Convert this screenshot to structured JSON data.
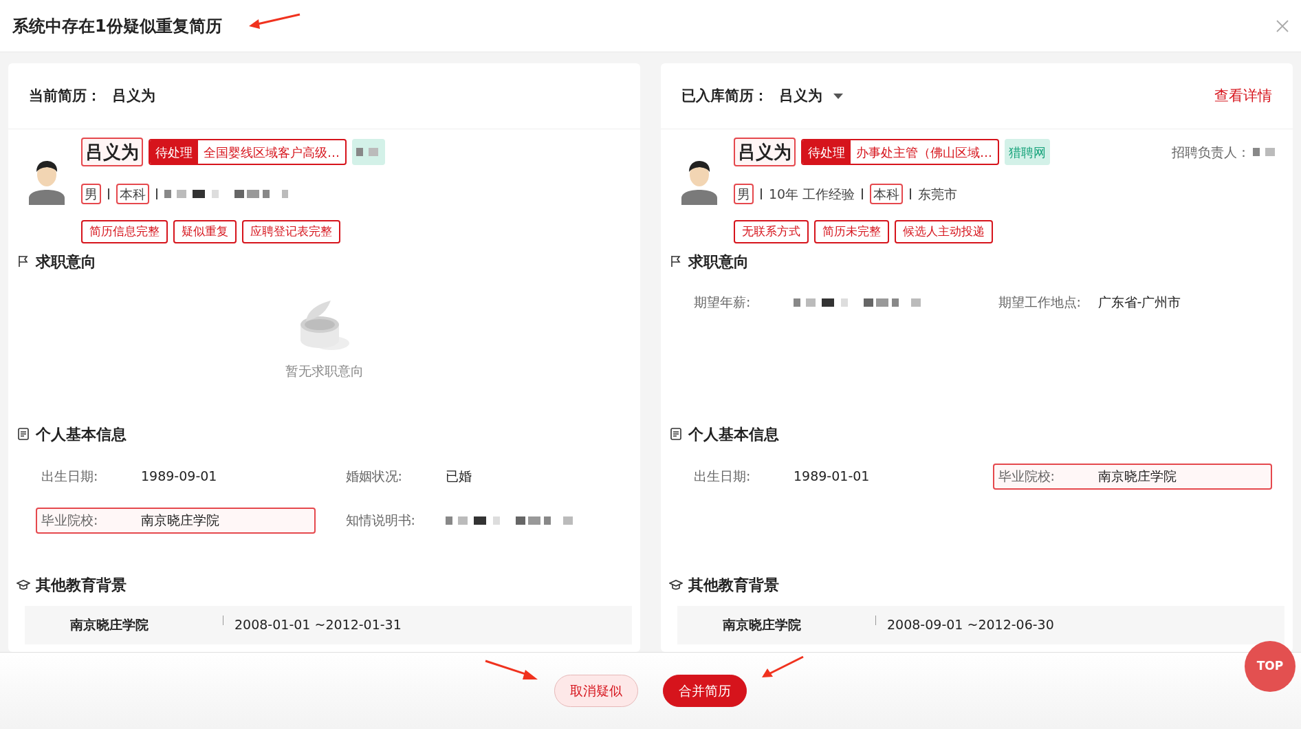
{
  "dialog": {
    "title": "系统中存在1份疑似重复简历"
  },
  "panels": [
    {
      "header_label": "当前简历：",
      "header_name": "吕义为",
      "name": "吕义为",
      "status": "待处理",
      "position": "全国婴线区域客户高级…",
      "source": {
        "blurred": true
      },
      "info": [
        {
          "kind": "tag",
          "text": "男"
        },
        {
          "kind": "tag",
          "text": "本科"
        },
        {
          "kind": "blurred"
        }
      ],
      "tags": [
        "简历信息完整",
        "疑似重复",
        "应聘登记表完整"
      ],
      "intent_title": "求职意向",
      "intent": {
        "empty": true,
        "empty_text": "暂无求职意向"
      },
      "basic_title": "个人基本信息",
      "basic": [
        {
          "label": "出生日期:",
          "value": "1989-09-01",
          "highlighted": false
        },
        {
          "label": "婚姻状况:",
          "value": "已婚",
          "highlighted": false
        },
        {
          "label": "毕业院校:",
          "value": "南京晓庄学院",
          "highlighted": true
        },
        {
          "label": "知情说明书:",
          "blurred": true,
          "highlighted": false
        }
      ],
      "edu_title": "其他教育背景",
      "education": [
        {
          "school": "南京晓庄学院",
          "period": "2008-01-01 ~2012-01-31"
        }
      ]
    },
    {
      "header_label": "已入库简历：",
      "header_name": "吕义为",
      "dropdown": true,
      "link": "查看详情",
      "name": "吕义为",
      "status": "待处理",
      "position": "办事处主管（佛山区域…",
      "source": {
        "text": "猎聘网"
      },
      "recruiter_label": "招聘负责人：",
      "info": [
        {
          "kind": "tag",
          "text": "男"
        },
        {
          "kind": "text",
          "text": "10年 工作经验"
        },
        {
          "kind": "tag",
          "text": "本科"
        },
        {
          "kind": "text",
          "text": "东莞市"
        }
      ],
      "tags": [
        "无联系方式",
        "简历未完整",
        "候选人主动投递"
      ],
      "intent_title": "求职意向",
      "intent": {
        "fields": [
          {
            "label": "期望年薪:",
            "blurred": true
          },
          {
            "label": "期望工作地点:",
            "value": "广东省-广州市"
          }
        ]
      },
      "basic_title": "个人基本信息",
      "basic": [
        {
          "label": "出生日期:",
          "value": "1989-01-01",
          "highlighted": false
        },
        {
          "label": "毕业院校:",
          "value": "南京晓庄学院",
          "highlighted": true
        }
      ],
      "edu_title": "其他教育背景",
      "education": [
        {
          "school": "南京晓庄学院",
          "period": "2008-09-01 ~2012-06-30"
        }
      ]
    }
  ],
  "buttons": [
    {
      "label": "取消疑似",
      "kind": "secondary"
    },
    {
      "label": "合并简历",
      "kind": "primary"
    }
  ],
  "top_button": "TOP"
}
